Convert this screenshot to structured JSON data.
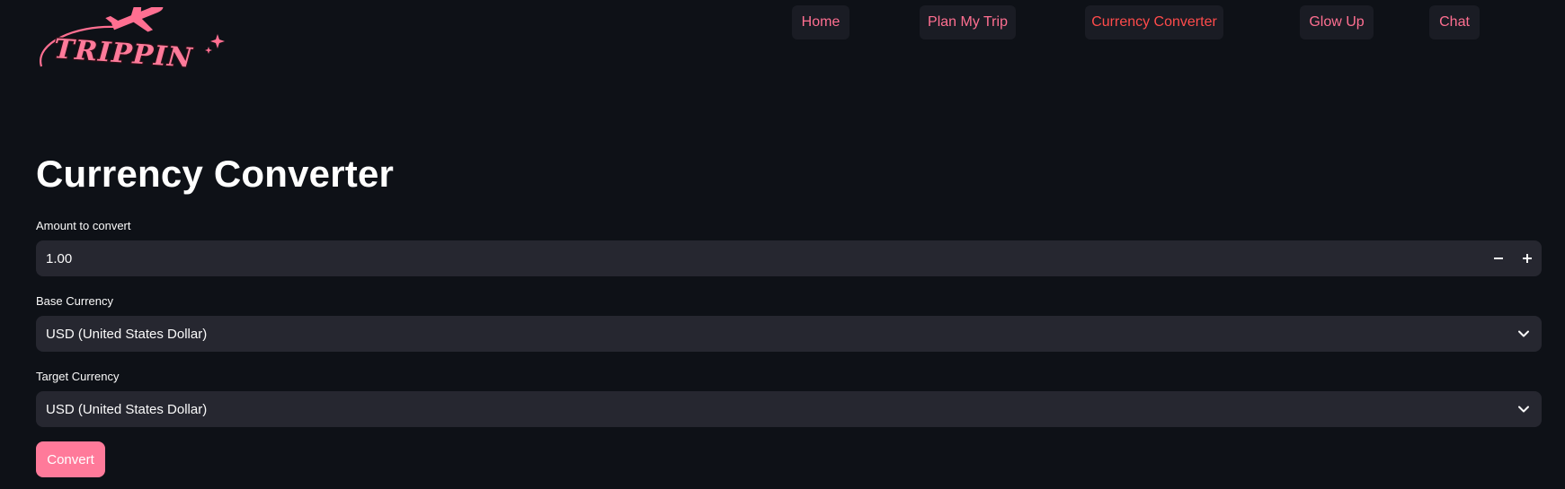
{
  "brand": {
    "logo_text": "TRIPPIN",
    "accent_color": "#ff6f91"
  },
  "nav": {
    "items": [
      {
        "label": "Home",
        "icon": null
      },
      {
        "label": "Plan My Trip",
        "icon": null
      },
      {
        "label": "Currency Converter",
        "active": true
      },
      {
        "label": "Glow Up"
      },
      {
        "label": "Chat"
      }
    ],
    "active_color": "#ff4b4b"
  },
  "main": {
    "title": "Currency Converter",
    "amount": {
      "label": "Amount to convert",
      "value": "1.00",
      "decrement_icon": "minus-icon",
      "increment_icon": "plus-icon"
    },
    "base_currency": {
      "label": "Base Currency",
      "selected": "USD (United States Dollar)",
      "icon": "chevron-down-icon"
    },
    "target_currency": {
      "label": "Target Currency",
      "selected": "USD (United States Dollar)",
      "icon": "chevron-down-icon"
    },
    "convert_button": {
      "label": "Convert",
      "color": "#ff7a9a"
    }
  },
  "colors": {
    "background": "#0e1117",
    "input_background": "#262730",
    "nav_background": "#1a1c24"
  }
}
